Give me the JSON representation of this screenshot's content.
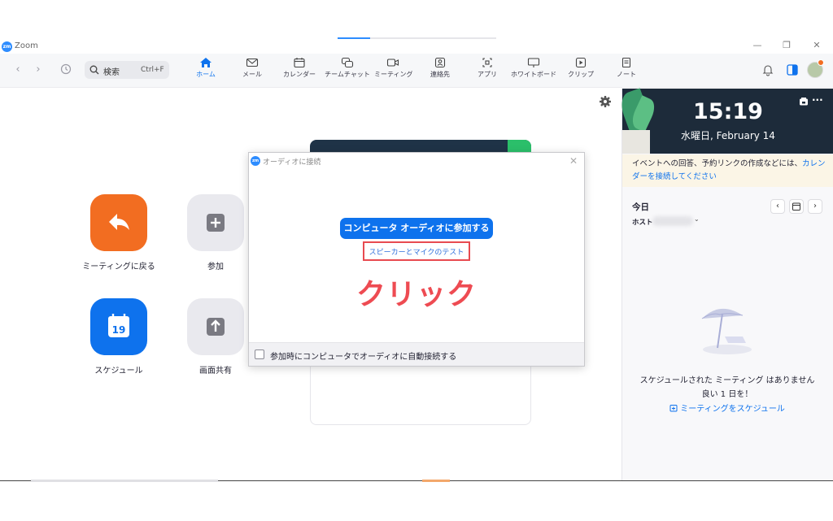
{
  "window": {
    "app_title": "Zoom",
    "logo_text": "zm"
  },
  "toolbar": {
    "search_label": "検索",
    "search_shortcut": "Ctrl+F",
    "tabs": [
      {
        "label": "ホーム",
        "icon": "home-icon",
        "active": true
      },
      {
        "label": "メール",
        "icon": "mail-icon"
      },
      {
        "label": "カレンダー",
        "icon": "calendar-icon"
      },
      {
        "label": "チームチャット",
        "icon": "chat-icon"
      },
      {
        "label": "ミーティング",
        "icon": "video-icon"
      },
      {
        "label": "連絡先",
        "icon": "contacts-icon"
      },
      {
        "label": "アプリ",
        "icon": "apps-icon"
      },
      {
        "label": "ホワイトボード",
        "icon": "whiteboard-icon"
      },
      {
        "label": "クリップ",
        "icon": "clips-icon"
      },
      {
        "label": "ノート",
        "icon": "notes-icon"
      }
    ]
  },
  "home": {
    "buttons": [
      {
        "label": "ミーティングに戻る",
        "icon": "return-arrow-icon",
        "color": "#f26d21"
      },
      {
        "label": "参加",
        "icon": "plus-icon",
        "color": "#e9e9ee"
      },
      {
        "label": "スケジュール",
        "icon": "calendar-19-icon",
        "color": "#0e72ed",
        "day": "19"
      },
      {
        "label": "画面共有",
        "icon": "share-up-arrow-icon",
        "color": "#e9e9ee"
      }
    ]
  },
  "dialog": {
    "title": "オーディオに接続",
    "primary_button": "コンピュータ オーディオに参加する",
    "test_link": "スピーカーとマイクのテスト",
    "annotation": "クリック",
    "auto_join_label": "参加時にコンピュータでオーディオに自動接続する",
    "auto_join_checked": false
  },
  "right_panel": {
    "time": "15:19",
    "date": "水曜日, February 14",
    "notice_text": "イベントへの回答、予約リンクの作成などには、",
    "notice_link": "カレンダーを接続してください",
    "today_label": "今日",
    "host_label": "ホスト",
    "empty_line1": "スケジュールされた ミーティング はありません",
    "empty_line2": "良い 1 日を！",
    "schedule_link": "ミーティングをスケジュール"
  },
  "colors": {
    "accent": "#0e72ed",
    "annotation_red": "#ee4b52",
    "orange": "#f26d21"
  }
}
